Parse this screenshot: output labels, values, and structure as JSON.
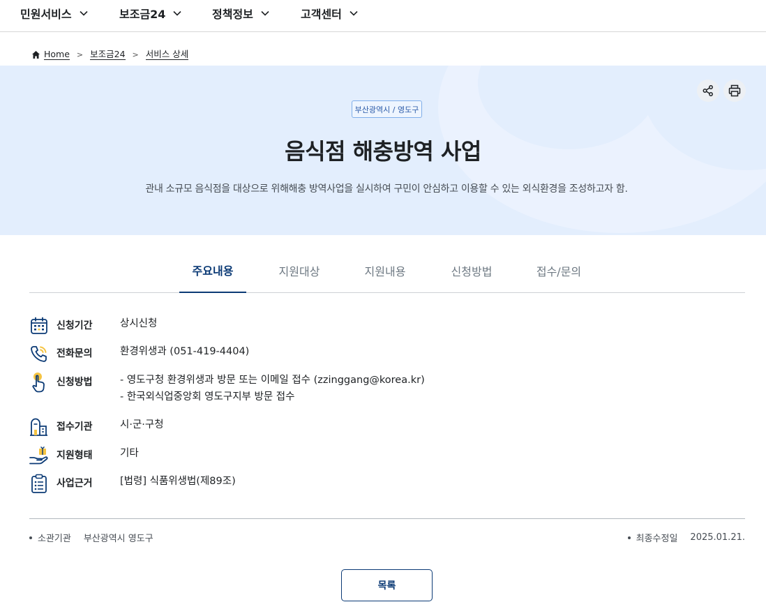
{
  "nav": {
    "items": [
      {
        "label": "민원서비스"
      },
      {
        "label": "보조금24"
      },
      {
        "label": "정책정보"
      },
      {
        "label": "고객센터"
      }
    ]
  },
  "breadcrumb": {
    "home": "Home",
    "level1": "보조금24",
    "level2": "서비스 상세"
  },
  "hero": {
    "region": "부산광역시 / 영도구",
    "title": "음식점 해충방역 사업",
    "description": "관내 소규모 음식점을 대상으로 위해해충 방역사업을 실시하여 구민이 안심하고 이용할 수 있는 외식환경을 조성하고자 함."
  },
  "tabs": [
    {
      "label": "주요내용",
      "active": true
    },
    {
      "label": "지원대상",
      "active": false
    },
    {
      "label": "지원내용",
      "active": false
    },
    {
      "label": "신청방법",
      "active": false
    },
    {
      "label": "접수/문의",
      "active": false
    }
  ],
  "info": {
    "period": {
      "label": "신청기간",
      "value": "상시신청",
      "icon": "calendar-icon"
    },
    "phone": {
      "label": "전화문의",
      "value": "환경위생과 (051-419-4404)",
      "icon": "phone-icon"
    },
    "method": {
      "label": "신청방법",
      "line1": "- 영도구청 환경위생과 방문 또는 이메일 접수 (zzinggang@korea.kr)",
      "line2": "- 한국외식업중앙회 영도구지부 방문 접수",
      "icon": "hand-pointer-icon"
    },
    "agency": {
      "label": "접수기관",
      "value": "시·군·구청",
      "icon": "building-icon"
    },
    "type": {
      "label": "지원형태",
      "value": "기타",
      "icon": "hand-gift-icon"
    },
    "basis": {
      "label": "사업근거",
      "value": "[법령] 식품위생법(제89조)",
      "icon": "clipboard-icon"
    }
  },
  "meta": {
    "org_key": "소관기관",
    "org_value": "부산광역시 영도구",
    "updated_key": "최종수정일",
    "updated_value": "2025.01.21."
  },
  "list_button": "목록",
  "colors": {
    "primary": "#0b3a75",
    "hero_bg": "#e3eefd",
    "icon_yellow": "#f5c443"
  }
}
